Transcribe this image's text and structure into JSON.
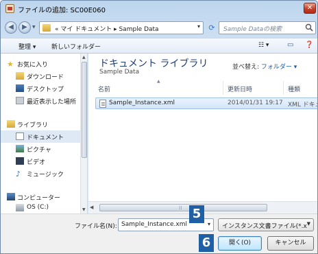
{
  "window": {
    "title": "ファイルの追加: SC00E060",
    "close_glyph": "✕"
  },
  "navbar": {
    "back_glyph": "◀",
    "forward_glyph": "▶",
    "address_path": "« マイ ドキュメント ▸ Sample Data",
    "search_placeholder": "Sample Dataの検索"
  },
  "toolbar": {
    "organize": "整理 ▾",
    "new_folder": "新しいフォルダー",
    "view_glyph": "☷ ▾"
  },
  "sidebar": {
    "items": [
      {
        "label": "お気に入り"
      },
      {
        "label": "ダウンロード"
      },
      {
        "label": "デスクトップ"
      },
      {
        "label": "最近表示した場所"
      },
      {
        "label": "ライブラリ"
      },
      {
        "label": "ドキュメント"
      },
      {
        "label": "ピクチャ"
      },
      {
        "label": "ビデオ"
      },
      {
        "label": "ミュージック"
      },
      {
        "label": "コンピューター"
      },
      {
        "label": "OS (C:)"
      }
    ]
  },
  "library": {
    "title": "ドキュメント ライブラリ",
    "subtitle": "Sample Data",
    "arrange_label": "並べ替え:",
    "arrange_value": "フォルダー ▾"
  },
  "columns": {
    "name": "名前",
    "date": "更新日時",
    "type": "種類"
  },
  "files": [
    {
      "name": "Sample_Instance.xml",
      "date": "2014/01/31 19:17",
      "type": "XML ドキュメ"
    }
  ],
  "footer": {
    "filename_label": "ファイル名(N):",
    "filename_value": "Sample_Instance.xml",
    "filetype_value": "インスタンス文書ファイル(*.x",
    "open_button": "開く(O)",
    "cancel_button": "キャンセル"
  },
  "badges": {
    "step_filename": "5",
    "step_open": "6"
  },
  "colors": {
    "badge": "#1e5fa6",
    "selection": "#d3e5fa",
    "library_title": "#1e3d73"
  }
}
